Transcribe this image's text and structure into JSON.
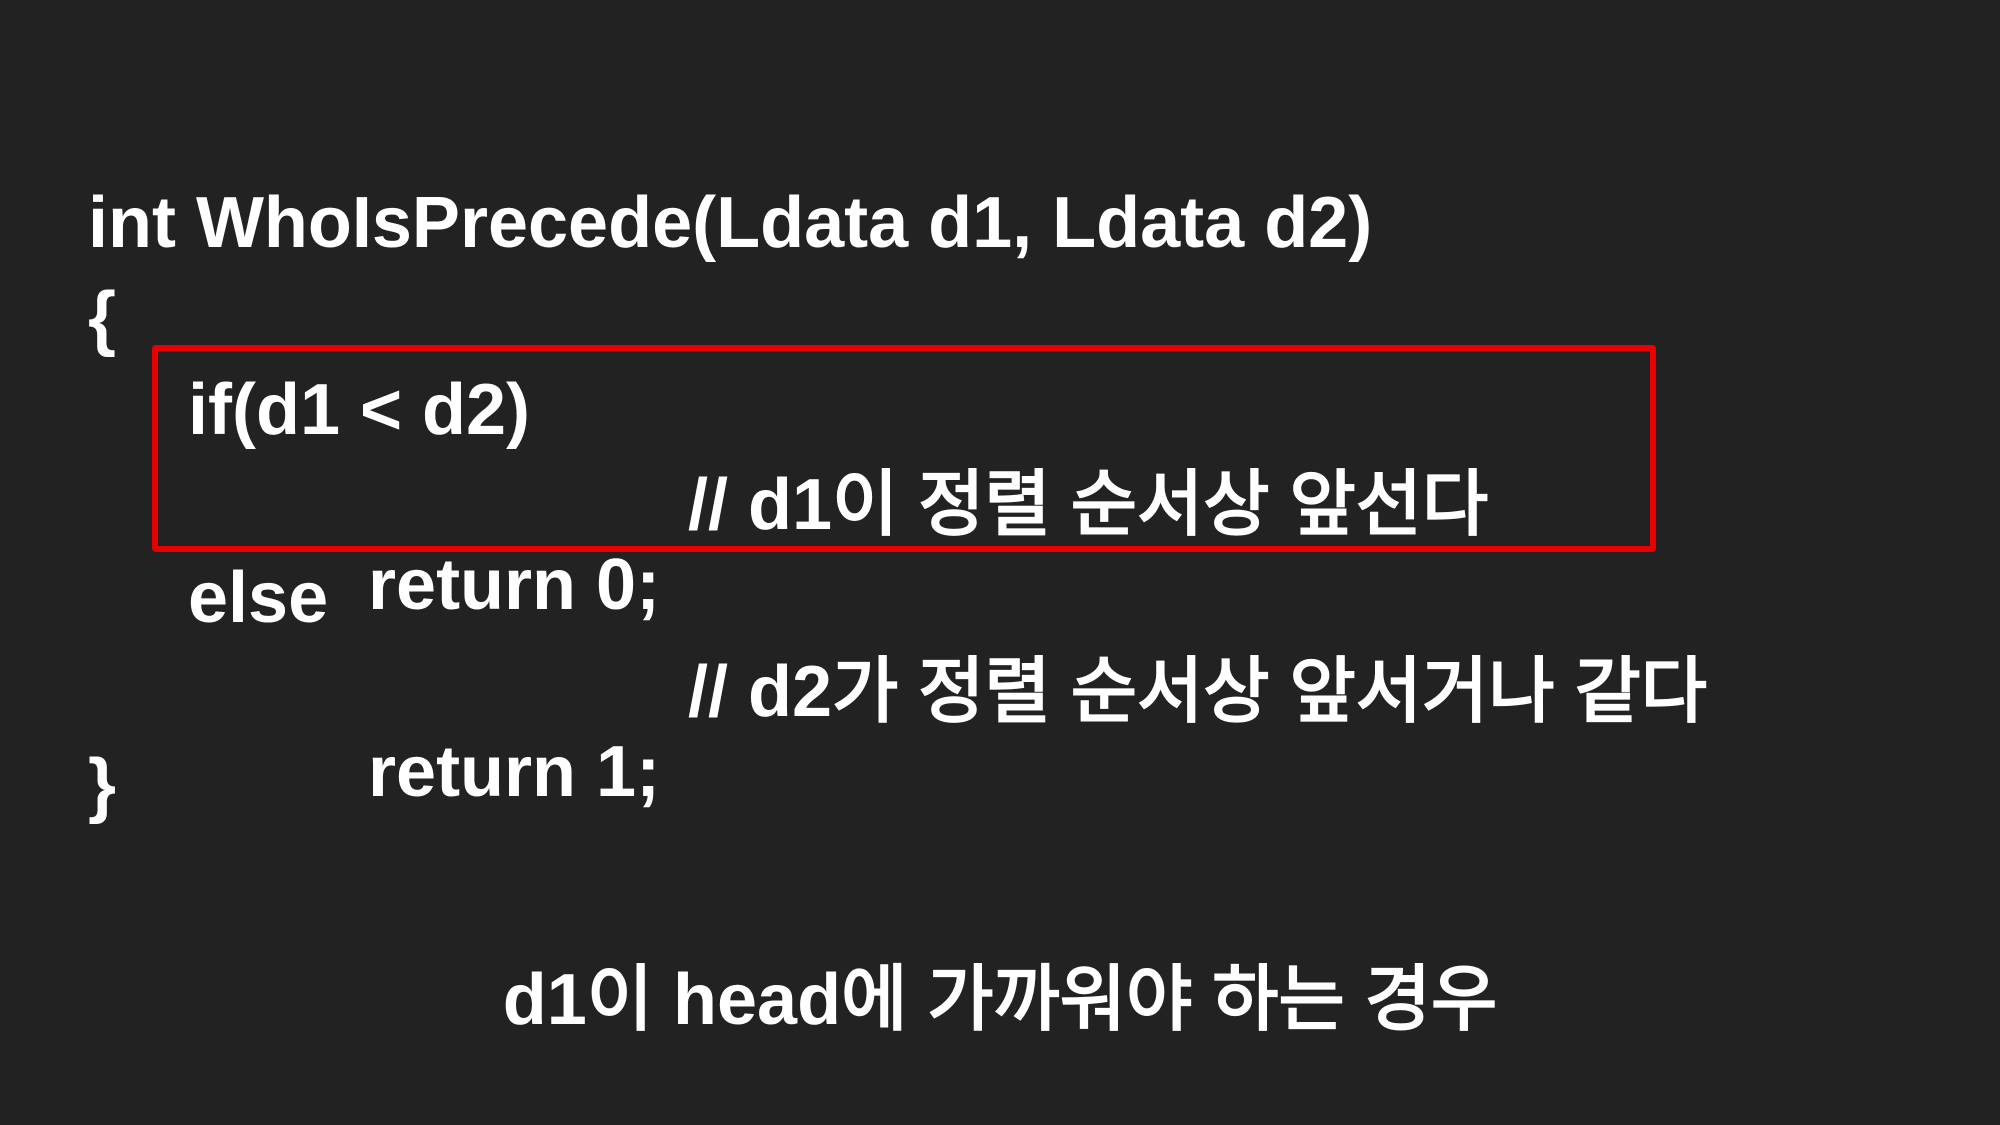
{
  "code": {
    "signature": "int WhoIsPrecede(Ldata d1, Ldata d2)",
    "open_brace": "{",
    "if_line": "if(d1 < d2)",
    "return0": "return 0;",
    "comment0": "// d1이 정렬 순서상 앞선다",
    "else_line": "else",
    "return1": "return 1;",
    "comment1": "// d2가 정렬 순서상 앞서거나 같다",
    "close_brace": "}"
  },
  "caption": "d1이 head에 가까워야 하는 경우",
  "colors": {
    "background": "#222222",
    "text": "#ffffff",
    "highlight": "#e60000"
  }
}
